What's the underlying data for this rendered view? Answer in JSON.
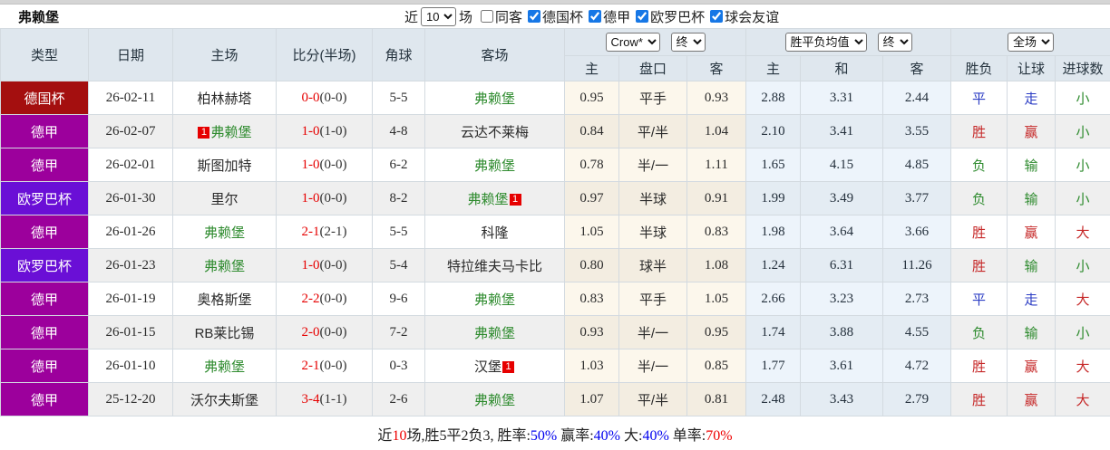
{
  "titlebar": {
    "team": "弗赖堡",
    "recent_label": "近",
    "recent_value": "10",
    "games_label": "场",
    "same_venue_label": "同客",
    "same_venue_checked": false,
    "league_filters": [
      {
        "label": "德国杯",
        "checked": true
      },
      {
        "label": "德甲",
        "checked": true
      },
      {
        "label": "欧罗巴杯",
        "checked": true
      },
      {
        "label": "球会友谊",
        "checked": true
      }
    ]
  },
  "header": {
    "type": "类型",
    "date": "日期",
    "home": "主场",
    "score": "比分(半场)",
    "corner": "角球",
    "away": "客场",
    "odds_source_select": "Crow*",
    "odds_time_select": "终",
    "odds_home": "主",
    "odds_handicap": "盘口",
    "odds_away": "客",
    "avg_type_select": "胜平负均值",
    "avg_time_select": "终",
    "avg_home": "主",
    "avg_draw": "和",
    "avg_away": "客",
    "fulltime_select": "全场",
    "result_wdl": "胜负",
    "result_handicap": "让球",
    "result_goals": "进球数"
  },
  "colors": {
    "league_german_cup": "#a40f0f",
    "league_bundesliga": "#9c009c",
    "league_europa": "#6a0fd6",
    "score_red": "#e60000",
    "team_green": "#2e8b2e",
    "result_red": "#c62828",
    "result_blue": "#2b3cc4",
    "result_green": "#2e8b2e",
    "crow_column_bg": "#fcf7ec",
    "avg_column_bg": "#edf4fb",
    "header_bg": "#dfe7ee"
  },
  "rows": [
    {
      "type": "德国杯",
      "date": "26-02-11",
      "home": "柏林赫塔",
      "score": "0-0",
      "half": "(0-0)",
      "corner": "5-5",
      "away": "弗赖堡",
      "odds_home": "0.95",
      "handicap": "平手",
      "odds_away": "0.93",
      "avg_home": "2.88",
      "avg_draw": "3.31",
      "avg_away": "2.44",
      "wdl": "平",
      "let": "走",
      "goals": "小"
    },
    {
      "type": "德甲",
      "date": "26-02-07",
      "home_badge": "1",
      "home": "弗赖堡",
      "score": "1-0",
      "half": "(1-0)",
      "corner": "4-8",
      "away": "云达不莱梅",
      "odds_home": "0.84",
      "handicap": "平/半",
      "odds_away": "1.04",
      "avg_home": "2.10",
      "avg_draw": "3.41",
      "avg_away": "3.55",
      "wdl": "胜",
      "let": "赢",
      "goals": "小"
    },
    {
      "type": "德甲",
      "date": "26-02-01",
      "home": "斯图加特",
      "score": "1-0",
      "half": "(0-0)",
      "corner": "6-2",
      "away": "弗赖堡",
      "odds_home": "0.78",
      "handicap": "半/一",
      "odds_away": "1.11",
      "avg_home": "1.65",
      "avg_draw": "4.15",
      "avg_away": "4.85",
      "wdl": "负",
      "let": "输",
      "goals": "小"
    },
    {
      "type": "欧罗巴杯",
      "date": "26-01-30",
      "home": "里尔",
      "score": "1-0",
      "half": "(0-0)",
      "corner": "8-2",
      "away": "弗赖堡",
      "away_badge": "1",
      "odds_home": "0.97",
      "handicap": "半球",
      "odds_away": "0.91",
      "avg_home": "1.99",
      "avg_draw": "3.49",
      "avg_away": "3.77",
      "wdl": "负",
      "let": "输",
      "goals": "小"
    },
    {
      "type": "德甲",
      "date": "26-01-26",
      "home": "弗赖堡",
      "score": "2-1",
      "half": "(2-1)",
      "corner": "5-5",
      "away": "科隆",
      "odds_home": "1.05",
      "handicap": "半球",
      "odds_away": "0.83",
      "avg_home": "1.98",
      "avg_draw": "3.64",
      "avg_away": "3.66",
      "wdl": "胜",
      "let": "赢",
      "goals": "大"
    },
    {
      "type": "欧罗巴杯",
      "date": "26-01-23",
      "home": "弗赖堡",
      "score": "1-0",
      "half": "(0-0)",
      "corner": "5-4",
      "away": "特拉维夫马卡比",
      "odds_home": "0.80",
      "handicap": "球半",
      "odds_away": "1.08",
      "avg_home": "1.24",
      "avg_draw": "6.31",
      "avg_away": "11.26",
      "wdl": "胜",
      "let": "输",
      "goals": "小"
    },
    {
      "type": "德甲",
      "date": "26-01-19",
      "home": "奥格斯堡",
      "score": "2-2",
      "half": "(0-0)",
      "corner": "9-6",
      "away": "弗赖堡",
      "odds_home": "0.83",
      "handicap": "平手",
      "odds_away": "1.05",
      "avg_home": "2.66",
      "avg_draw": "3.23",
      "avg_away": "2.73",
      "wdl": "平",
      "let": "走",
      "goals": "大"
    },
    {
      "type": "德甲",
      "date": "26-01-15",
      "home": "RB莱比锡",
      "score": "2-0",
      "half": "(0-0)",
      "corner": "7-2",
      "away": "弗赖堡",
      "odds_home": "0.93",
      "handicap": "半/一",
      "odds_away": "0.95",
      "avg_home": "1.74",
      "avg_draw": "3.88",
      "avg_away": "4.55",
      "wdl": "负",
      "let": "输",
      "goals": "小"
    },
    {
      "type": "德甲",
      "date": "26-01-10",
      "home": "弗赖堡",
      "score": "2-1",
      "half": "(0-0)",
      "corner": "0-3",
      "away": "汉堡",
      "away_badge": "1",
      "odds_home": "1.03",
      "handicap": "半/一",
      "odds_away": "0.85",
      "avg_home": "1.77",
      "avg_draw": "3.61",
      "avg_away": "4.72",
      "wdl": "胜",
      "let": "赢",
      "goals": "大"
    },
    {
      "type": "德甲",
      "date": "25-12-20",
      "home": "沃尔夫斯堡",
      "score": "3-4",
      "half": "(1-1)",
      "corner": "2-6",
      "away": "弗赖堡",
      "odds_home": "1.07",
      "handicap": "平/半",
      "odds_away": "0.81",
      "avg_home": "2.48",
      "avg_draw": "3.43",
      "avg_away": "2.79",
      "wdl": "胜",
      "let": "赢",
      "goals": "大"
    }
  ],
  "footer": {
    "seg1": "近",
    "seg2": "10",
    "seg3": "场,胜5平2负3, 胜率:",
    "seg4": "50%",
    "seg5": " 赢率:",
    "seg6": "40%",
    "seg7": " 大:",
    "seg8": "40%",
    "seg9": " 单率:",
    "seg10": "70%"
  }
}
